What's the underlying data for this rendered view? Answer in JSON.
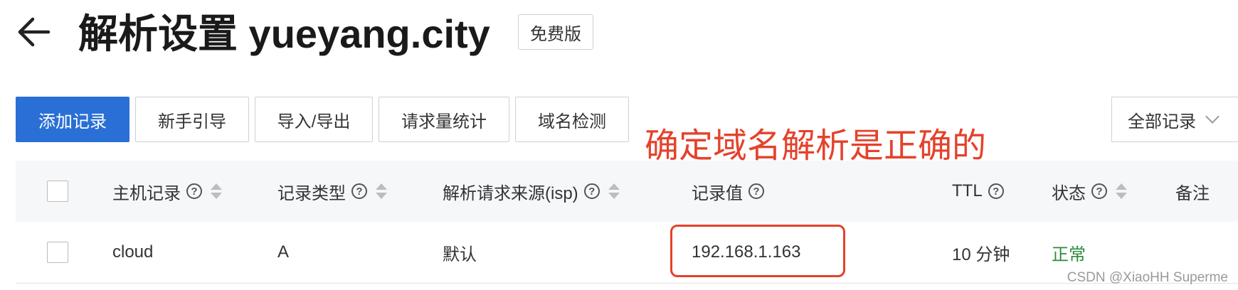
{
  "header": {
    "title": "解析设置 yueyang.city",
    "badge": "免费版"
  },
  "toolbar": {
    "buttons": [
      {
        "label": "添加记录"
      },
      {
        "label": "新手引导"
      },
      {
        "label": "导入/导出"
      },
      {
        "label": "请求量统计"
      },
      {
        "label": "域名检测"
      }
    ],
    "filter_label": "全部记录"
  },
  "annotation": "确定域名解析是正确的",
  "table": {
    "columns": [
      {
        "label": "主机记录"
      },
      {
        "label": "记录类型"
      },
      {
        "label": "解析请求来源(isp)"
      },
      {
        "label": "记录值"
      },
      {
        "label": "TTL"
      },
      {
        "label": "状态"
      },
      {
        "label": "备注"
      }
    ],
    "rows": [
      {
        "host": "cloud",
        "type": "A",
        "source": "默认",
        "value": "192.168.1.163",
        "ttl": "10 分钟",
        "status": "正常"
      }
    ]
  },
  "watermark": "CSDN @XiaoHH Superme",
  "colors": {
    "primary": "#2a6fd6",
    "status_ok": "#2e8b3d",
    "annotation": "#e4422b"
  },
  "icons": [
    "back-arrow-icon",
    "help-icon",
    "sort-icon",
    "chevron-down-icon"
  ]
}
